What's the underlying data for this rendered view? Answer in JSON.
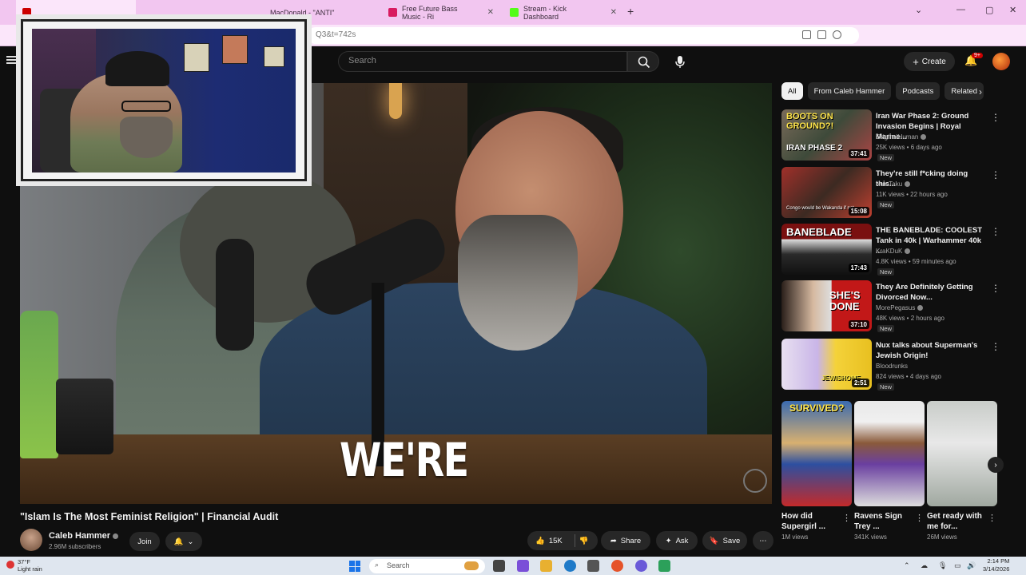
{
  "browser": {
    "tabs": [
      {
        "label": "",
        "active": true
      },
      {
        "label": "MacDonald - \"ANTI\"",
        "active": false
      },
      {
        "label": "Free Future Bass Music - Ri",
        "active": false
      },
      {
        "label": "Stream - Kick Dashboard",
        "active": false
      }
    ],
    "url": "Q3&t=742s"
  },
  "youtube": {
    "search_placeholder": "Search",
    "create_label": "Create",
    "notification_count": "9+"
  },
  "video": {
    "caption": "WE'RE",
    "title": "\"Islam Is The Most Feminist Religion\" | Financial Audit",
    "channel": "Caleb Hammer",
    "subscribers": "2.96M subscribers",
    "join_label": "Join",
    "likes": "15K",
    "share_label": "Share",
    "ask_label": "Ask",
    "save_label": "Save"
  },
  "chips": [
    "All",
    "From Caleb Hammer",
    "Podcasts",
    "Related"
  ],
  "recommendations": [
    {
      "title": "Iran War Phase 2: Ground Invasion Begins | Royal Marine...",
      "channel": "OriginalHuman",
      "meta": "25K views • 6 days ago",
      "badge": "New",
      "duration": "37:41",
      "thumb_text": "BOOTS ON GROUND?!",
      "thumb_sub": "IRAN PHASE 2"
    },
    {
      "title": "They're still f*cking doing this...",
      "channel": "Nux Taku",
      "meta": "11K views • 22 hours ago",
      "badge": "New",
      "duration": "15:08",
      "thumb_text": "",
      "thumb_sub": "Congo would be Wakanda if not"
    },
    {
      "title": "THE BANEBLADE: COOLEST Tank in 40k | Warhammer 40k ...",
      "channel": "KraKDuK",
      "meta": "4.8K views • 59 minutes ago",
      "badge": "New",
      "duration": "17:43",
      "thumb_text": "BANEBLADE",
      "thumb_sub": ""
    },
    {
      "title": "They Are Definitely Getting Divorced Now...",
      "channel": "MorePegasus",
      "meta": "48K views • 2 hours ago",
      "badge": "New",
      "duration": "37:10",
      "thumb_text": "SHE'S DONE",
      "thumb_sub": ""
    },
    {
      "title": "Nux talks about Superman's Jewish Origin!",
      "channel": "Bloodrunks",
      "meta": "824 views • 4 days ago",
      "badge": "New",
      "duration": "2:51",
      "thumb_text": "",
      "thumb_sub": "JEWISHOME"
    }
  ],
  "shorts": [
    {
      "title": "How did Supergirl ...",
      "views": "1M views",
      "thumb_text": "SURVIVED?"
    },
    {
      "title": "Ravens Sign Trey ...",
      "views": "341K views",
      "thumb_text": ""
    },
    {
      "title": "Get ready with me for...",
      "views": "26M views",
      "thumb_text": ""
    }
  ],
  "taskbar": {
    "temperature": "37°F",
    "weather": "Light rain",
    "search_label": "Search",
    "time": "2:14 PM",
    "date": "3/14/2026"
  }
}
